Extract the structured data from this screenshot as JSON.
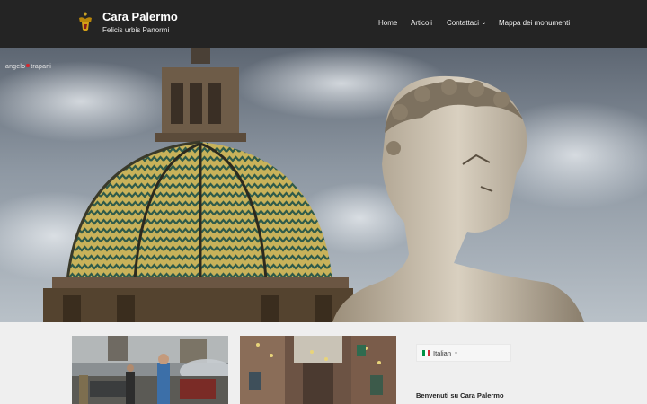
{
  "site": {
    "title": "Cara Palermo",
    "tagline": "Felicis urbis Panormi"
  },
  "nav": {
    "items": [
      {
        "label": "Home"
      },
      {
        "label": "Articoli"
      },
      {
        "label": "Contattaci",
        "has_dropdown": true
      },
      {
        "label": "Mappa dei monumenti"
      }
    ]
  },
  "hero": {
    "watermark_left": "angelo",
    "watermark_right": "trapani"
  },
  "sidebar": {
    "language": {
      "selected": "Italian",
      "flag": "italy-flag-icon"
    },
    "welcome_title": "Benvenuti su Cara Palermo"
  },
  "colors": {
    "header_bg": "#242424",
    "page_bg": "#efefef",
    "watermark_dot": "#d8262c"
  }
}
